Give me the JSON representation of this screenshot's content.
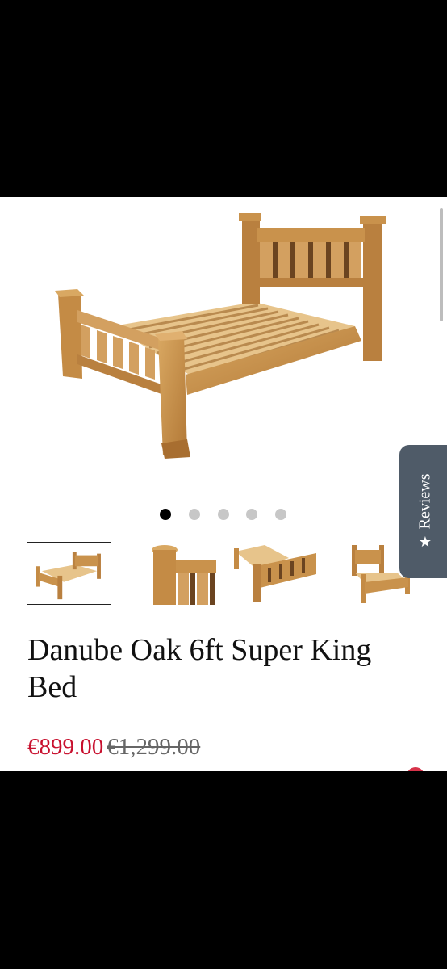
{
  "product": {
    "title": "Danube Oak 6ft Super King Bed",
    "sale_price": "€899.00",
    "original_price": "€1,299.00"
  },
  "carousel": {
    "dot_count": 5,
    "active_index": 0,
    "thumbnails": [
      "bed-full-view",
      "headboard-post-closeup",
      "bed-side-angle",
      "bed-front-view"
    ],
    "selected_thumbnail": 0
  },
  "reviews_tab": {
    "label": "Reviews",
    "icon": "star-icon"
  },
  "colors": {
    "sale": "#c8102e",
    "reviews_tab_bg": "#4f5b68",
    "wood": "#c9924c"
  }
}
